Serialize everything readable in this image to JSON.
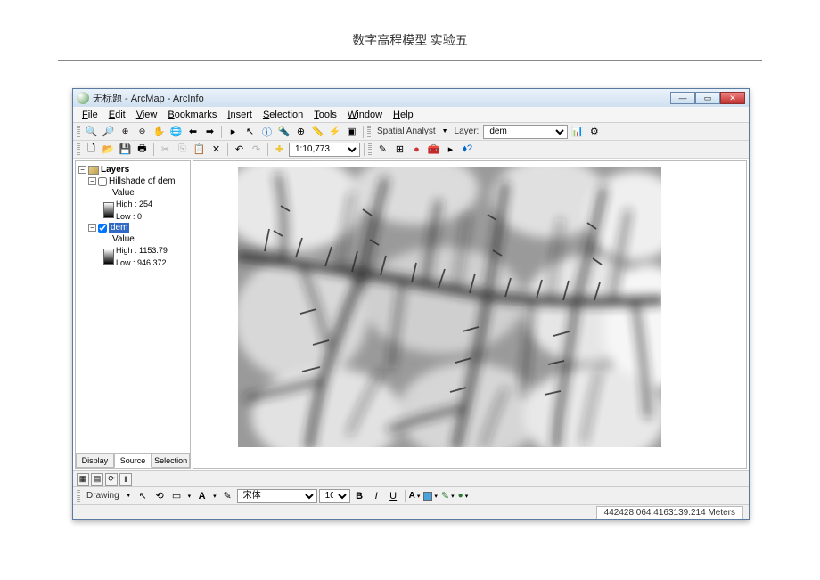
{
  "page_header": "数字高程模型 实验五",
  "titlebar": {
    "title": "无标题 - ArcMap - ArcInfo",
    "min": "—",
    "max": "▭",
    "close": "✕"
  },
  "menu": {
    "file": "File",
    "edit": "Edit",
    "view": "View",
    "bookmarks": "Bookmarks",
    "insert": "Insert",
    "selection": "Selection",
    "tools": "Tools",
    "window": "Window",
    "help": "Help"
  },
  "toolbar1": {
    "spatial_analyst": "Spatial Analyst",
    "layer_label": "Layer:",
    "layer_value": "dem"
  },
  "toolbar2": {
    "scale": "1:10,773"
  },
  "toc": {
    "root": "Layers",
    "layer1": {
      "name": "Hillshade of dem",
      "checked": false,
      "value_label": "Value",
      "high": "High : 254",
      "low": "Low : 0"
    },
    "layer2": {
      "name": "dem",
      "checked": true,
      "value_label": "Value",
      "high": "High : 1153.79",
      "low": "Low : 946.372"
    },
    "tabs": {
      "display": "Display",
      "source": "Source",
      "selection": "Selection"
    }
  },
  "draw": {
    "label": "Drawing",
    "font": "宋体",
    "size": "10",
    "bold": "B",
    "italic": "I",
    "underline": "U"
  },
  "status": {
    "coords": "442428.064 4163139.214 Meters"
  }
}
